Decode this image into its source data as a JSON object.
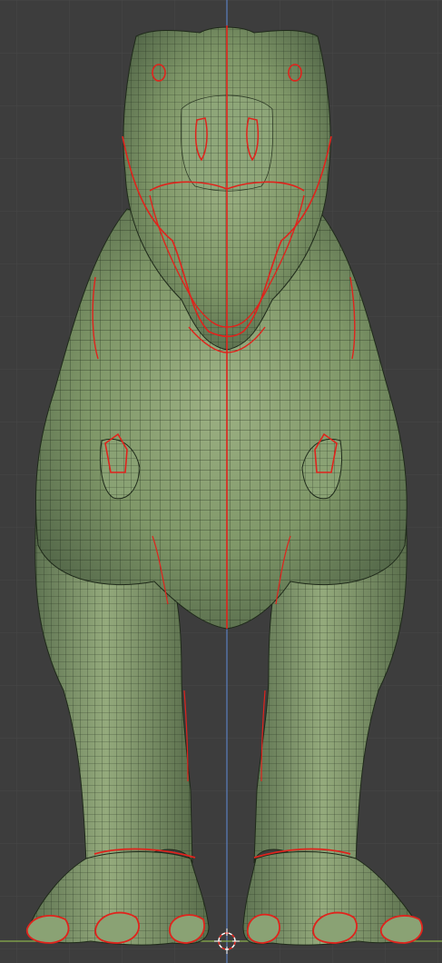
{
  "viewport": {
    "background": "#3d3d3d",
    "grid_color": "#484848",
    "axis_y_color": "#5a7fbf",
    "axis_x_color": "#8ab04c",
    "view": "front-orthographic",
    "mode": "edit-mode-wireframe-overlay"
  },
  "model": {
    "subject": "t-rex-mesh",
    "base_color": "#7f9768",
    "dark_color": "#55694a",
    "wire_color": "#1f2a1a",
    "seam_color": "#e0231c",
    "symmetry_axis": "x-mirror"
  },
  "icons": {
    "origin": "3d-cursor-icon"
  }
}
